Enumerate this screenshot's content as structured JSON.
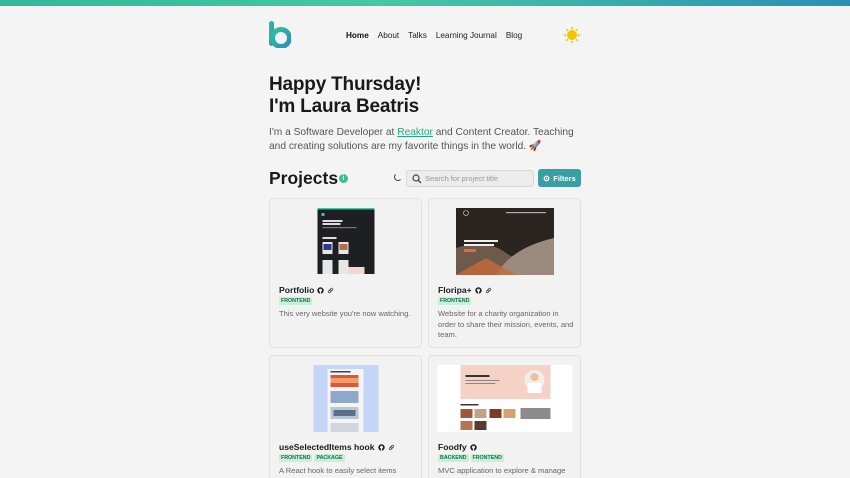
{
  "nav": {
    "items": [
      {
        "label": "Home",
        "active": true
      },
      {
        "label": "About"
      },
      {
        "label": "Talks"
      },
      {
        "label": "Learning Journal"
      },
      {
        "label": "Blog"
      }
    ],
    "theme_icon": "sun-icon",
    "logo_icon": "b-logo-icon"
  },
  "hero": {
    "line1": "Happy Thursday!",
    "line2": "I'm Laura Beatris",
    "intro_before": "I'm a Software Developer at ",
    "intro_link": "Reaktor",
    "intro_after": " and Content Creator. Teaching and creating solutions are my favorite things in the world. 🚀"
  },
  "projects": {
    "title": "Projects",
    "search_placeholder": "Search for project title",
    "filters_label": "Filters",
    "cards": [
      {
        "title": "Portfolio",
        "tags": [
          "FRONTEND"
        ],
        "description": "This very website you're now watching.",
        "links": [
          "github-icon",
          "link-icon"
        ]
      },
      {
        "title": "Floripa+",
        "tags": [
          "FRONTEND"
        ],
        "description": "Website for a charity organization in order to share their mission, events, and team.",
        "links": [
          "github-icon",
          "link-icon"
        ]
      },
      {
        "title": "useSelectedItems hook",
        "tags": [
          "FRONTEND",
          "PACKAGE"
        ],
        "description": "A React hook to easily select items",
        "links": [
          "github-icon",
          "link-icon"
        ]
      },
      {
        "title": "Foodfy",
        "tags": [
          "BACKEND",
          "FRONTEND"
        ],
        "description": "MVC application to explore & manage",
        "links": [
          "github-icon"
        ]
      }
    ]
  },
  "colors": {
    "accent": "#3a9fa3",
    "tag_bg": "#c9efd9",
    "tag_text": "#1d6e46",
    "link": "#2aa583"
  }
}
